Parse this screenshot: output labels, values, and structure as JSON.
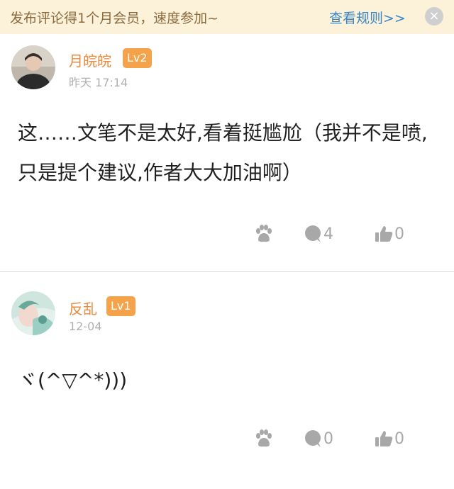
{
  "banner": {
    "text": "发布评论得1个月会员，速度参加~",
    "link": "查看规则>>",
    "close": "×"
  },
  "comments": [
    {
      "username": "月皖皖",
      "level": "Lv2",
      "time": "昨天 17:14",
      "text": "这……文笔不是太好,看着挺尴尬（我并不是喷,只是提个建议,作者大大加油啊）",
      "reply_count": "4",
      "like_count": "0"
    },
    {
      "username": "反乱",
      "level": "Lv1",
      "time": "12-04",
      "text": "ヾ(^▽^*)))",
      "reply_count": "0",
      "like_count": "0"
    }
  ],
  "colors": {
    "banner_bg": "#fbf2d9",
    "username": "#e98a3c",
    "level_badge": "#f5a34a",
    "link": "#3a86c8",
    "icon": "#a8a8a8"
  }
}
